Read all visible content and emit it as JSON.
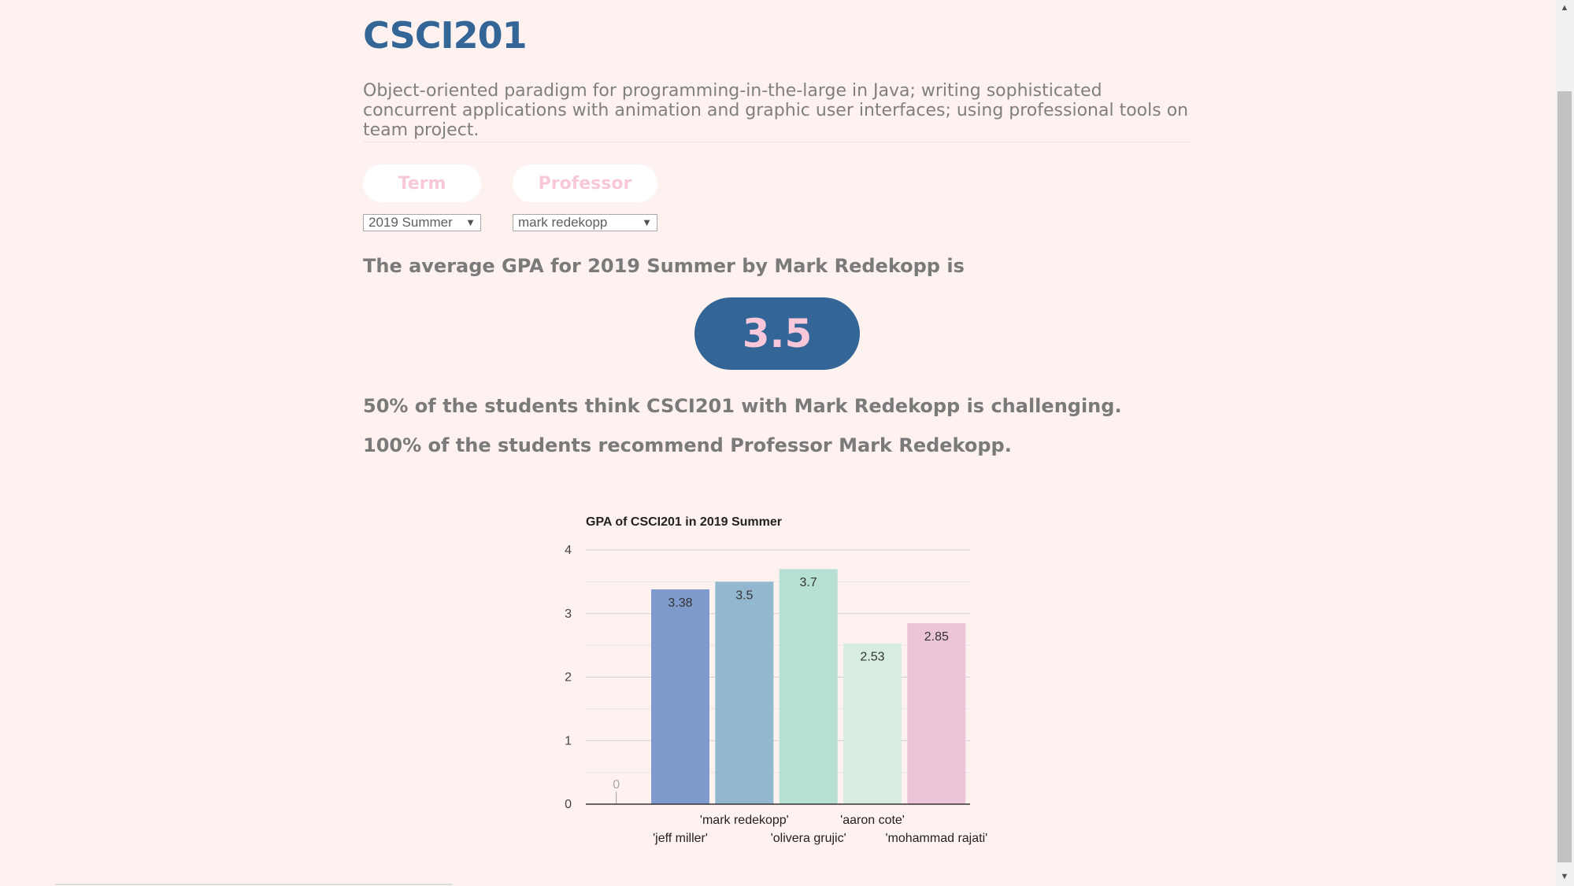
{
  "course": {
    "title": "CSCI201",
    "description": "Object-oriented paradigm for programming-in-the-large in Java; writing sophisticated concurrent applications with animation and graphic user interfaces; using professional tools on team project."
  },
  "filters": {
    "term_label": "Term",
    "professor_label": "Professor",
    "term_value": "2019 Summer",
    "professor_value": "mark redekopp"
  },
  "stats": {
    "avg_sentence": "The average GPA for 2019 Summer by Mark Redekopp is",
    "avg_gpa": "3.5",
    "challenging_sentence": "50% of the students think CSCI201 with Mark Redekopp is challenging.",
    "recommend_sentence": "100% of the students recommend Professor Mark Redekopp."
  },
  "colors": {
    "title": "#346597",
    "badge_bg": "#346597",
    "badge_text": "#f8c8da",
    "pill_text": "#f8c8d8",
    "background": "#fef2f1"
  },
  "chart_data": {
    "type": "bar",
    "title": "GPA of CSCI201 in 2019 Summer",
    "categories": [
      "0",
      "'jeff miller'",
      "'mark redekopp'",
      "'olivera grujic'",
      "'aaron cote'",
      "'mohammad rajati'"
    ],
    "values": [
      0,
      3.38,
      3.5,
      3.7,
      2.53,
      2.85
    ],
    "labels": [
      "0",
      "3.38",
      "3.5",
      "3.7",
      "2.53",
      "2.85"
    ],
    "colors": [
      "#9e9e9e",
      "#7f9acd",
      "#94b7d0",
      "#b5e0d3",
      "#d7ede2",
      "#ebc4d7"
    ],
    "ylim": [
      0,
      4
    ],
    "yticks": [
      "0",
      "1",
      "2",
      "3",
      "4"
    ],
    "grid": true,
    "legend": "none"
  }
}
